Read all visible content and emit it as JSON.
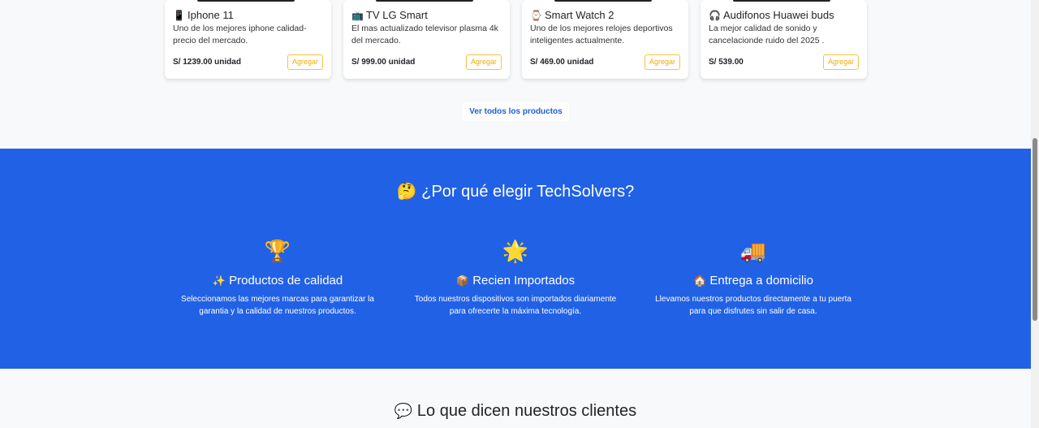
{
  "products": [
    {
      "icon": "mobile-phone-icon",
      "glyph": "📱",
      "name": "Iphone 11",
      "description": "Uno de los mejores iphone calidad-precio del mercado.",
      "price": "S/ 1239.00 unidad",
      "button": "Agregar"
    },
    {
      "icon": "television-icon",
      "glyph": "📺",
      "name": "TV LG Smart",
      "description": "El mas actualizado televisor plasma 4k del mercado.",
      "price": "S/ 999.00 unidad",
      "button": "Agregar"
    },
    {
      "icon": "watch-icon",
      "glyph": "⌚",
      "name": "Smart Watch 2",
      "description": "Uno de los mejores relojes deportivos inteligentes actualmente.",
      "price": "S/ 469.00 unidad",
      "button": "Agregar"
    },
    {
      "icon": "headphones-icon",
      "glyph": "🎧",
      "name": "Audifonos Huawei buds",
      "description": "La mejor calidad de sonido y cancelacionde ruido del 2025 .",
      "price": "S/ 539.00",
      "button": "Agregar"
    }
  ],
  "view_all_label": "Ver todos los productos",
  "why": {
    "emoji": "🤔",
    "title": "¿Por qué elegir TechSolvers?",
    "features": [
      {
        "big_icon": "trophy-icon",
        "big_glyph": "🏆",
        "small_icon": "sparkles-icon",
        "small_glyph": "✨",
        "title": "Productos de calidad",
        "description": "Seleccionamos las mejores marcas para garantizar la garantia y la calidad de nuestros productos."
      },
      {
        "big_icon": "star-burst-icon",
        "big_glyph": "🌟",
        "small_icon": "package-icon",
        "small_glyph": "📦",
        "title": "Recien Importados",
        "description": "Todos nuestros dispositivos son importados diariamente para ofrecerte la máxima tecnología."
      },
      {
        "big_icon": "delivery-truck-icon",
        "big_glyph": "🚚",
        "small_icon": "house-icon",
        "small_glyph": "🏠",
        "title": "Entrega a domicilio",
        "description": "Llevamos nuestros productos directamente a tu puerta para que disfrutes sin salir de casa."
      }
    ]
  },
  "testimonials": {
    "icon": "speech-bubble-icon",
    "glyph": "💬",
    "title": "Lo que dicen nuestros clientes"
  },
  "colors": {
    "accent_blue": "#2161e6",
    "link_blue": "#1d5ed8",
    "button_yellow": "#f0ad00"
  }
}
